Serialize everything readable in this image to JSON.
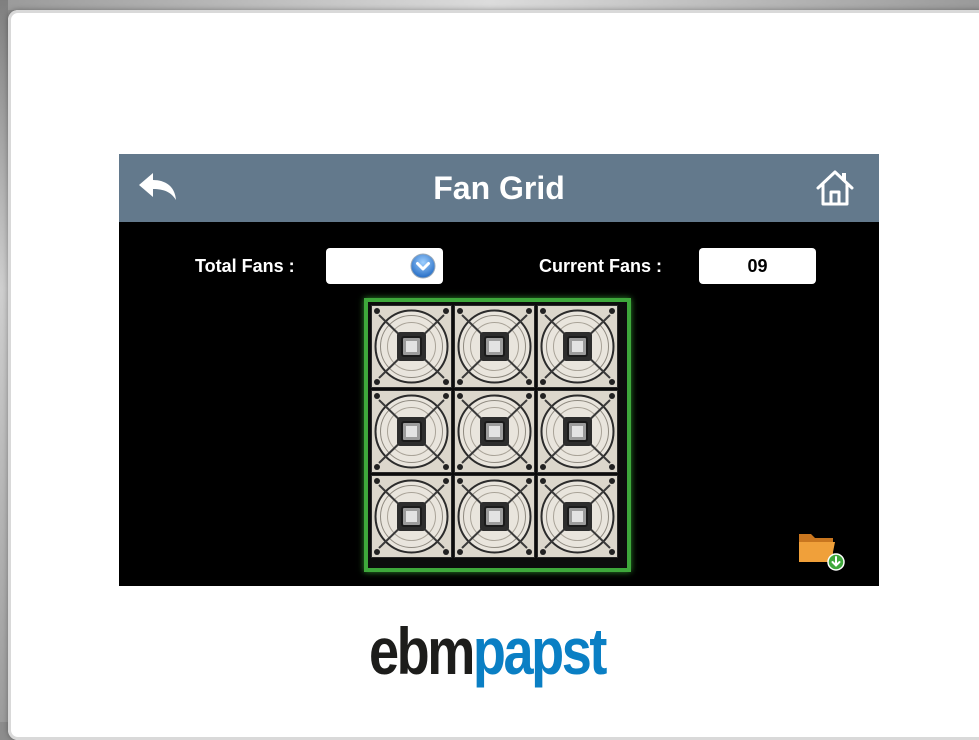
{
  "header": {
    "title": "Fan Grid",
    "back_icon": "back-arrow-icon",
    "home_icon": "home-icon"
  },
  "controls": {
    "total_fans_label": "Total Fans :",
    "total_fans_value": "",
    "current_fans_label": "Current Fans :",
    "current_fans_value": "09"
  },
  "fan_grid": {
    "rows": 3,
    "cols": 3,
    "fan_count": 9,
    "border_color": "#3ea83b"
  },
  "folder_icon": "folder-download-icon",
  "brand": {
    "part1": "ebm",
    "part2": "papst",
    "part1_color": "#1d1d1b",
    "part2_color": "#0a7fc4"
  },
  "colors": {
    "header_bg": "#63798c",
    "screen_bg": "#000000",
    "accent_green": "#3ea83b",
    "folder_orange": "#e8912c"
  }
}
